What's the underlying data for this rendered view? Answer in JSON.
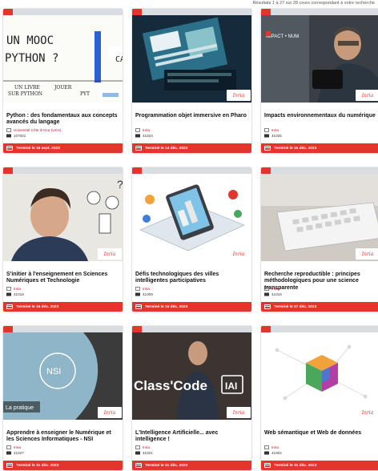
{
  "results": {
    "text": "Résultats 1 à 27 sur 28 cours correspondant à votre recherche"
  },
  "cards": [
    {
      "title": "Python : des fondamentaux aux concepts avancés du langage",
      "org": "Université Côte d'Azur (UCA)",
      "code": "107001",
      "status": "Terminé le 16 sept. 2023",
      "image_text": [
        "UN MOOC",
        "PYTHON ?",
        "UN LIVRE",
        "JOUER",
        "SUR PYTHON",
        "PYT",
        "CA"
      ]
    },
    {
      "title": "Programmation objet immersive en Pharo",
      "org": "Inria",
      "code": "41024",
      "status": "Terminé le 14 déc. 2023",
      "logo": "Inria"
    },
    {
      "title": "Impacts environnementaux du numérique",
      "org": "Inria",
      "code": "41025",
      "status": "Terminé le 15 déc. 2023",
      "logo": "Inria",
      "image_text": [
        "IMPACT • NUM"
      ]
    },
    {
      "title": "S'initier à l'enseignement en Sciences Numériques et Technologie",
      "org": "Inria",
      "code": "41018",
      "status": "Terminé le 15 déc. 2023",
      "logo": "Inria"
    },
    {
      "title": "Défis technologiques des villes intelligentes participatives",
      "org": "Inria",
      "code": "41009",
      "status": "Terminé le 15 déc. 2023",
      "logo": "Inria"
    },
    {
      "title": "Recherche reproductible : principes méthodologiques pour une science transparente",
      "org": "Inria",
      "code": "41016",
      "status": "Terminé le 27 déc. 2023",
      "logo": "Inria"
    },
    {
      "title": "Apprendre à enseigner le Numérique et les Sciences Informatiques - NSI",
      "org": "Inria",
      "code": "41027",
      "status": "Terminé le 31 déc. 2023",
      "logo": "Inria",
      "image_text": [
        "NSI",
        "La pratique"
      ]
    },
    {
      "title": "L'Intelligence Artificielle... avec intelligence !",
      "org": "Inria",
      "code": "41021",
      "status": "Terminé le 31 déc. 2023",
      "logo": "Inria",
      "image_text": [
        "Class'Code",
        "IAI"
      ]
    },
    {
      "title": "Web sémantique et Web de données",
      "org": "Inria",
      "code": "41002",
      "status": "Terminé le 31 déc. 2023",
      "logo": "Inria"
    }
  ],
  "colors": {
    "accent": "#e4352d",
    "org": "#c8102e",
    "strip": "#d9dde2"
  }
}
